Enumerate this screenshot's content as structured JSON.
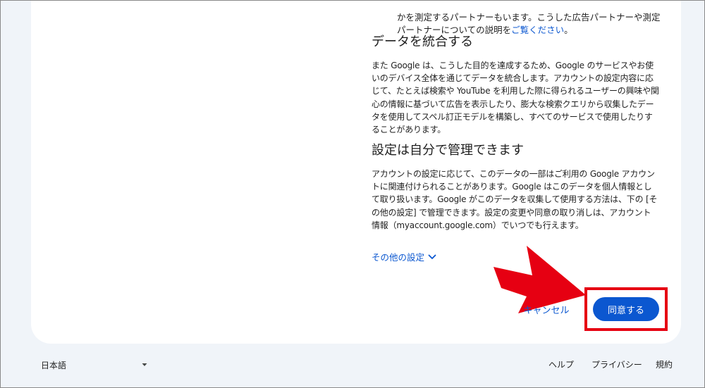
{
  "content": {
    "bullet_text_before_link": "かを測定するパートナーもいます。こうした広告パートナーや測定パートナーについての説明を",
    "bullet_link": "ご覧ください",
    "bullet_text_after_link": "。",
    "section1_title": "データを統合する",
    "section1_body": "また Google は、こうした目的を達成するため、Google のサービスやお使いのデバイス全体を通じてデータを統合します。アカウントの設定内容に応じて、たとえば検索や YouTube を利用した際に得られるユーザーの興味や関心の情報に基づいて広告を表示したり、膨大な検索クエリから収集したデータを使用してスペル訂正モデルを構築し、すべてのサービスで使用したりすることがあります。",
    "section2_title": "設定は自分で管理できます",
    "section2_body": "アカウントの設定に応じて、このデータの一部はご利用の Google アカウントに関連付けられることがあります。Google はこのデータを個人情報として取り扱います。Google がこのデータを収集して使用する方法は、下の [その他の設定] で管理できます。設定の変更や同意の取り消しは、アカウント情報（myaccount.google.com）でいつでも行えます。"
  },
  "actions": {
    "more_settings": "その他の設定",
    "cancel": "キャンセル",
    "agree": "同意する"
  },
  "footer": {
    "language": "日本語",
    "help": "ヘルプ",
    "privacy": "プライバシー",
    "terms": "規約"
  },
  "colors": {
    "accent": "#0b57d0",
    "annotation_red": "#e60012",
    "page_background": "#f0f4f9",
    "card_background": "#ffffff"
  },
  "icons": {
    "more_settings": "chevron-down-icon",
    "language_dropdown": "caret-down-icon",
    "annotation": "red-arrow-icon"
  }
}
